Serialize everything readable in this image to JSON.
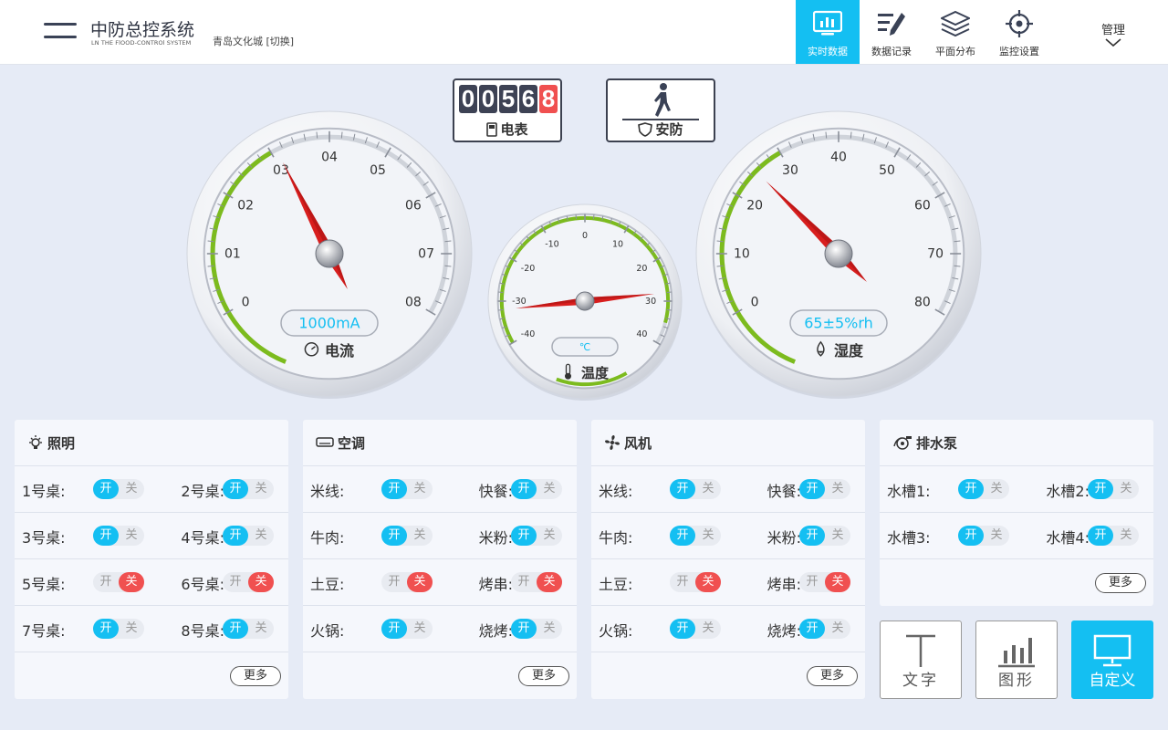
{
  "header": {
    "title": "中防总控系统",
    "subtitle": "LN THE FlOOD-CONTROl SYSTEM",
    "location": "青岛文化城 [切换]",
    "nav": [
      {
        "label": "实时数据",
        "icon": "monitor-chart-icon",
        "active": true
      },
      {
        "label": "数据记录",
        "icon": "list-pen-icon",
        "active": false
      },
      {
        "label": "平面分布",
        "icon": "layers-icon",
        "active": false
      },
      {
        "label": "监控设置",
        "icon": "target-icon",
        "active": false
      }
    ],
    "admin": "管理"
  },
  "meter": {
    "digits": [
      "0",
      "0",
      "5",
      "6",
      "8"
    ],
    "label": "电表"
  },
  "security": {
    "label": "安防"
  },
  "gauges": {
    "current": {
      "ticks": [
        "0",
        "01",
        "02",
        "03",
        "04",
        "05",
        "06",
        "07",
        "08"
      ],
      "readout": "1000mA",
      "label": "电流",
      "needle_value": 3.1
    },
    "temperature": {
      "ticks": [
        "-40",
        "-30",
        "-20",
        "-10",
        "0",
        "10",
        "20",
        "30",
        "40"
      ],
      "readout": "℃",
      "label": "温度",
      "needle_value": -32
    },
    "humidity": {
      "ticks": [
        "0",
        "10",
        "20",
        "30",
        "40",
        "50",
        "60",
        "70",
        "80"
      ],
      "readout": "65±5%rh",
      "label": "湿度",
      "needle_value": 25
    }
  },
  "toggle_text": {
    "on": "开",
    "off": "关"
  },
  "more_label": "更多",
  "panels": {
    "lighting": {
      "title": "照明",
      "items": [
        {
          "name": "1号桌:",
          "on": true
        },
        {
          "name": "2号桌:",
          "on": true
        },
        {
          "name": "3号桌:",
          "on": true
        },
        {
          "name": "4号桌:",
          "on": true
        },
        {
          "name": "5号桌:",
          "on": false
        },
        {
          "name": "6号桌:",
          "on": false
        },
        {
          "name": "7号桌:",
          "on": true
        },
        {
          "name": "8号桌:",
          "on": true
        }
      ]
    },
    "ac": {
      "title": "空调",
      "items": [
        {
          "name": "米线:",
          "on": true
        },
        {
          "name": "快餐:",
          "on": true
        },
        {
          "name": "牛肉:",
          "on": true
        },
        {
          "name": "米粉:",
          "on": true
        },
        {
          "name": "土豆:",
          "on": false
        },
        {
          "name": "烤串:",
          "on": false
        },
        {
          "name": "火锅:",
          "on": true
        },
        {
          "name": "烧烤:",
          "on": true
        }
      ]
    },
    "fan": {
      "title": "风机",
      "items": [
        {
          "name": "米线:",
          "on": true
        },
        {
          "name": "快餐:",
          "on": true
        },
        {
          "name": "牛肉:",
          "on": true
        },
        {
          "name": "米粉:",
          "on": true
        },
        {
          "name": "土豆:",
          "on": false
        },
        {
          "name": "烤串:",
          "on": false
        },
        {
          "name": "火锅:",
          "on": true
        },
        {
          "name": "烧烤:",
          "on": true
        }
      ]
    },
    "pump": {
      "title": "排水泵",
      "items": [
        {
          "name": "水槽1:",
          "on": true
        },
        {
          "name": "水槽2:",
          "on": true
        },
        {
          "name": "水槽3:",
          "on": true
        },
        {
          "name": "水槽4:",
          "on": true
        }
      ]
    }
  },
  "tools": {
    "text": "文字",
    "chart": "图形",
    "custom": "自定义"
  },
  "colors": {
    "accent": "#14bff2",
    "off": "#f05050",
    "needle": "#d81e1e",
    "arc": "#7cbb1e"
  }
}
